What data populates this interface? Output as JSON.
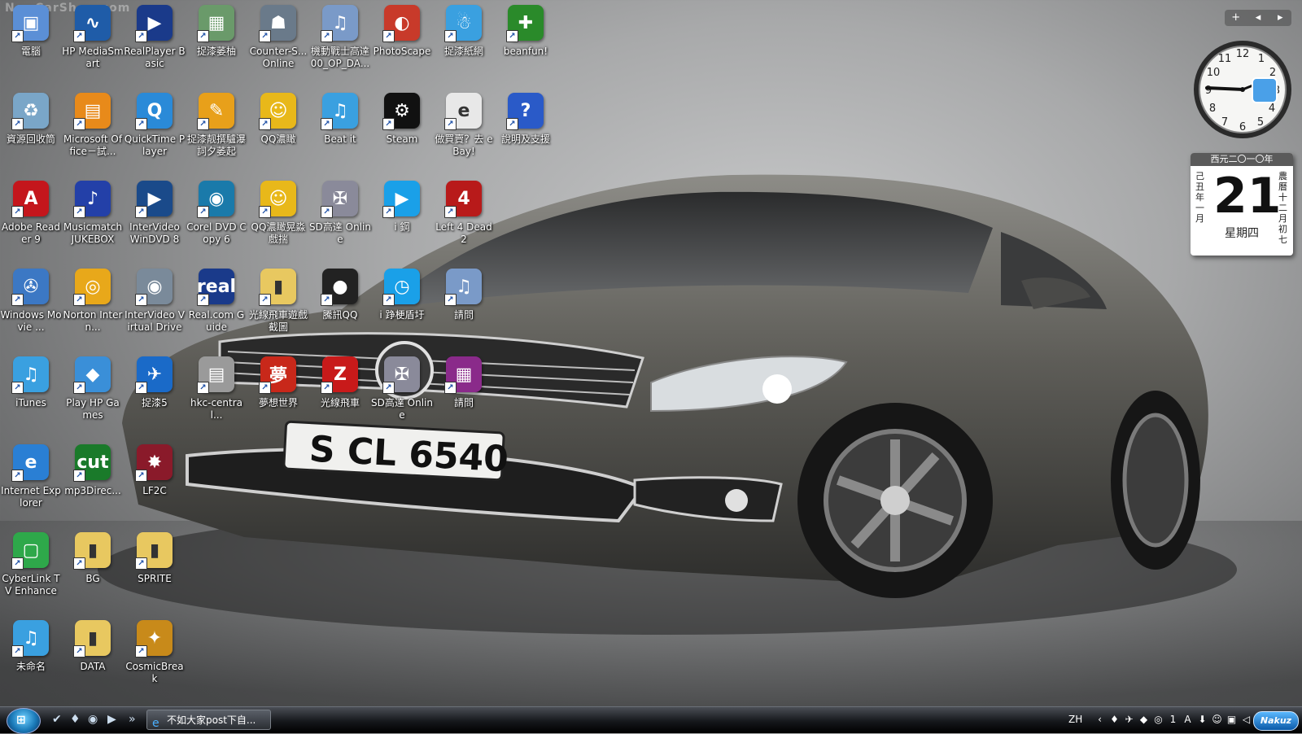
{
  "watermark": "NewCarShow.com",
  "wallpaper": {
    "plate": "S CL 6540"
  },
  "columns": [
    [
      {
        "label": "電腦",
        "icon": "computer-icon",
        "glyph": "▣",
        "color": "#5b8fd6"
      },
      {
        "label": "資源回收筒",
        "icon": "recycle-bin-icon",
        "glyph": "♻",
        "color": "#7aa6c8"
      },
      {
        "label": "Adobe Reader 9",
        "icon": "adobe-reader-icon",
        "glyph": "A",
        "color": "#c4161c"
      },
      {
        "label": "Windows Movie ...",
        "icon": "windows-movie-maker-icon",
        "glyph": "✇",
        "color": "#3c78c4"
      },
      {
        "label": "iTunes",
        "icon": "itunes-icon",
        "glyph": "♫",
        "color": "#3aa0e0"
      },
      {
        "label": "Internet Explorer",
        "icon": "internet-explorer-icon",
        "glyph": "e",
        "color": "#2a7fd4"
      },
      {
        "label": "CyberLink TV Enhance",
        "icon": "cyberlink-tv-icon",
        "glyph": "▢",
        "color": "#2ea84a"
      },
      {
        "label": "未命名",
        "icon": "music-file-icon",
        "glyph": "♫",
        "color": "#3aa0e0"
      }
    ],
    [
      {
        "label": "HP MediaSmart",
        "icon": "hp-mediasmart-icon",
        "glyph": "∿",
        "color": "#1f5ca8"
      },
      {
        "label": "Microsoft Office－試...",
        "icon": "microsoft-office-icon",
        "glyph": "▤",
        "color": "#e88a1a"
      },
      {
        "label": "Musicmatch JUKEBOX",
        "icon": "musicmatch-icon",
        "glyph": "♪",
        "color": "#2340a8"
      },
      {
        "label": "Norton Intern...",
        "icon": "norton-icon",
        "glyph": "◎",
        "color": "#e8a81a"
      },
      {
        "label": "Play HP Games",
        "icon": "hp-games-icon",
        "glyph": "◆",
        "color": "#3a8fd8"
      },
      {
        "label": "mp3Direc...",
        "icon": "mp3directcut-icon",
        "glyph": "cut",
        "color": "#1a7a2a"
      },
      {
        "label": "BG",
        "icon": "folder-icon",
        "glyph": "▮",
        "color": "#e8c860"
      },
      {
        "label": "DATA",
        "icon": "folder-icon",
        "glyph": "▮",
        "color": "#e8c860"
      }
    ],
    [
      {
        "label": "RealPlayer Basic",
        "icon": "realplayer-icon",
        "glyph": "▶",
        "color": "#1a3a8a"
      },
      {
        "label": "QuickTime Player",
        "icon": "quicktime-icon",
        "glyph": "Q",
        "color": "#2a8ad8"
      },
      {
        "label": "InterVideo WinDVD 8",
        "icon": "windvd-icon",
        "glyph": "▶",
        "color": "#1a4a8a"
      },
      {
        "label": "InterVideo Virtual Drive",
        "icon": "virtual-drive-icon",
        "glyph": "◉",
        "color": "#7a8a9a"
      },
      {
        "label": "捉漆5",
        "icon": "app-bird-icon",
        "glyph": "✈",
        "color": "#1a6ac8"
      },
      {
        "label": "LF2C",
        "icon": "game-icon",
        "glyph": "✸",
        "color": "#8a1a2a"
      },
      {
        "label": "SPRITE",
        "icon": "folder-icon",
        "glyph": "▮",
        "color": "#e8c860"
      },
      {
        "label": "CosmicBreak",
        "icon": "cosmicbreak-icon",
        "glyph": "✦",
        "color": "#c88a1a"
      }
    ],
    [
      {
        "label": "捉漆萎柚",
        "icon": "app-window-icon",
        "glyph": "▦",
        "color": "#6a9a6a"
      },
      {
        "label": "捉漆靓撰驢瀑詞夕萎起",
        "icon": "app-orange-icon",
        "glyph": "✎",
        "color": "#e8a01a"
      },
      {
        "label": "Corel DVD Copy 6",
        "icon": "corel-dvd-icon",
        "glyph": "◉",
        "color": "#1a7aaa"
      },
      {
        "label": "Real.com Guide",
        "icon": "realcom-guide-icon",
        "glyph": "real",
        "color": "#1a3a8a"
      },
      {
        "label": "hkc-central...",
        "icon": "pdf-file-icon",
        "glyph": "▤",
        "color": "#9a9a9a"
      }
    ],
    [
      {
        "label": "Counter-S... Online",
        "icon": "counter-strike-icon",
        "glyph": "☗",
        "color": "#6a7a8a"
      },
      {
        "label": "QQ濃瞰",
        "icon": "qq-game-icon",
        "glyph": "☺",
        "color": "#e8b81a"
      },
      {
        "label": "QQ濃瞰晃淼戲揣",
        "icon": "qq-game-icon",
        "glyph": "☺",
        "color": "#e8b81a"
      },
      {
        "label": "光線飛車遊戲截圖",
        "icon": "folder-icon",
        "glyph": "▮",
        "color": "#e8c860"
      },
      {
        "label": "夢想世界",
        "icon": "dream-world-icon",
        "glyph": "夢",
        "color": "#c8281a"
      }
    ],
    [
      {
        "label": "機動戰士高達00_OP_DA...",
        "icon": "mp3-file-icon",
        "glyph": "♫",
        "color": "#7a9ac8"
      },
      {
        "label": "Beat it",
        "icon": "itunes-icon",
        "glyph": "♫",
        "color": "#3aa0e0"
      },
      {
        "label": "SD高達 Online",
        "icon": "sd-gundam-icon",
        "glyph": "✠",
        "color": "#8a8a9a"
      },
      {
        "label": "騰訊QQ",
        "icon": "qq-penguin-icon",
        "glyph": "●",
        "color": "#222222"
      },
      {
        "label": "光線飛車",
        "icon": "racing-icon",
        "glyph": "Z",
        "color": "#c81a1a"
      }
    ],
    [
      {
        "label": "PhotoScape",
        "icon": "photoscape-icon",
        "glyph": "◐",
        "color": "#c83a2a"
      },
      {
        "label": "Steam",
        "icon": "steam-icon",
        "glyph": "⚙",
        "color": "#111111"
      },
      {
        "label": "i 鋼",
        "icon": "media-play-icon",
        "glyph": "▶",
        "color": "#1aa0e8"
      },
      {
        "label": "i 踭梗盾圩",
        "icon": "gauge-icon",
        "glyph": "◷",
        "color": "#1aa0e8"
      },
      {
        "label": "SD高達 Online",
        "icon": "sd-gundam-icon",
        "glyph": "✠",
        "color": "#8a8a9a"
      }
    ],
    [
      {
        "label": "捉漆紙網",
        "icon": "app-person-icon",
        "glyph": "☃",
        "color": "#3aa0e0"
      },
      {
        "label": "做買賣？去 eBay!",
        "icon": "ebay-icon",
        "glyph": "e",
        "color": "#e8e8e8"
      },
      {
        "label": "Left 4 Dead 2",
        "icon": "left4dead-icon",
        "glyph": "4",
        "color": "#b81a1a"
      },
      {
        "label": "請問",
        "icon": "mp3-file-icon",
        "glyph": "♫",
        "color": "#7a9ac8"
      },
      {
        "label": "請問",
        "icon": "winrar-icon",
        "glyph": "▦",
        "color": "#8a2a8a"
      }
    ],
    [
      {
        "label": "beanfun!",
        "icon": "beanfun-icon",
        "glyph": "✚",
        "color": "#2a8a2a"
      },
      {
        "label": "說明及支援",
        "icon": "help-icon",
        "glyph": "?",
        "color": "#2a5ac8"
      }
    ]
  ],
  "gadgets": {
    "buttons": [
      "+",
      "◂",
      "▸"
    ],
    "calendar": {
      "header": "西元二〇一〇年",
      "day": "21",
      "weekday": "星期四",
      "left": "己丑年 一月",
      "right": "農曆十二月初七"
    }
  },
  "taskbar": {
    "task_label": "不如大家post下自...",
    "overflow": "»",
    "lang": "ZH",
    "tray_icons": [
      "‹",
      "♦",
      "✈",
      "◆",
      "◎",
      "1",
      "A",
      "⬇",
      "☺",
      "▣",
      "◁"
    ],
    "nakuz": "Nakuz"
  },
  "colors": {
    "taskbar": "#15171b",
    "accent": "#2a7fd4"
  }
}
